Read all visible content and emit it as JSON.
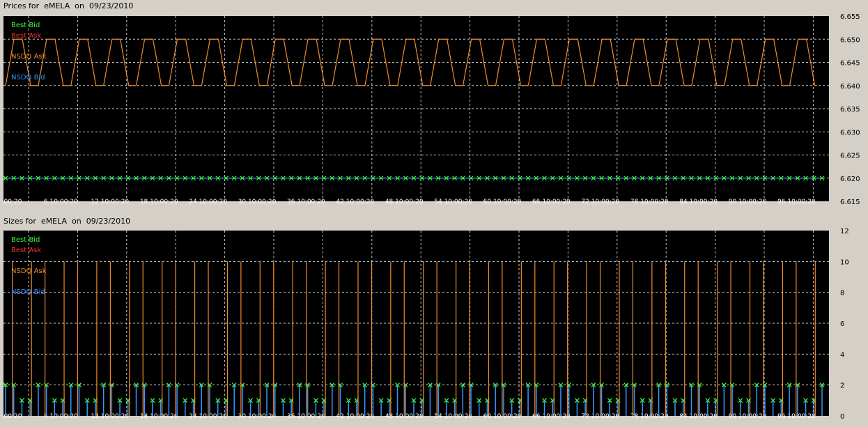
{
  "colors": {
    "background": "#000000",
    "grid": "#c8c8c8",
    "best_bid": "#33ff33",
    "best_ask": "#ff3030",
    "nsdq_ask": "#f08c2a",
    "nsdq_bid": "#3c96ff",
    "axis_text": "#000000"
  },
  "panels": {
    "prices": {
      "title": "Prices for  eMELA  on  09/23/2010"
    },
    "sizes": {
      "title": "Sizes for  eMELA  on  09/23/2010"
    }
  },
  "legend": {
    "best_bid": "Best Bid",
    "best_ask": "Best Ask",
    "nsdq_ask": "NSDQ Ask",
    "nsdq_bid": "NSDQ Bid"
  },
  "x_tick_labels": [
    ":00:20",
    "6 10:00:20",
    "12 10:00:20",
    "18 10:00:20",
    "24 10:00:20",
    "30 10:00:20",
    "36 10:00:20",
    "42 10:00:20",
    "48 10:00:20",
    "54 10:00:20",
    "60 10:00:20",
    "66 10:00:20",
    "72 10:00:20",
    "78 10:00:20",
    "84 10:00:20",
    "90 10:00:20",
    "96 10:00:20"
  ],
  "chart_data": [
    {
      "type": "line",
      "title": "Prices for  eMELA  on  09/23/2010",
      "y_axis_position": "right",
      "ylim": [
        6.615,
        6.655
      ],
      "y_ticks": [
        "6.615",
        "6.620",
        "6.625",
        "6.630",
        "6.635",
        "6.640",
        "6.645",
        "6.650",
        "6.655"
      ],
      "legend_position": "top-left",
      "grid": true,
      "series": [
        {
          "name": "Best Bid",
          "value": 6.62,
          "marker": "x",
          "count": 101
        },
        {
          "name": "NSDQ Ask",
          "pattern": "alternates between 6.640 and 6.650",
          "low": 6.64,
          "high": 6.65
        },
        {
          "name": "NSDQ Bid",
          "value": 6.62
        }
      ]
    },
    {
      "type": "bar",
      "title": "Sizes for  eMELA  on  09/23/2010",
      "y_axis_position": "right",
      "ylim": [
        0,
        12
      ],
      "y_ticks": [
        "0",
        "2",
        "4",
        "6",
        "8",
        "10",
        "12"
      ],
      "legend_position": "top-left",
      "grid": true,
      "series": [
        {
          "name": "Best Bid",
          "pattern": "markers alternating pairs of 2 and 1",
          "marker": "x",
          "values_cycle": [
            2,
            2,
            1,
            1
          ]
        },
        {
          "name": "NSDQ Ask",
          "pattern": "spikes to 10, otherwise 0",
          "spike_value": 10
        },
        {
          "name": "NSDQ Bid",
          "pattern": "bars alternating pairs of 2 and 1",
          "values_cycle": [
            2,
            2,
            1,
            1
          ]
        }
      ]
    }
  ]
}
